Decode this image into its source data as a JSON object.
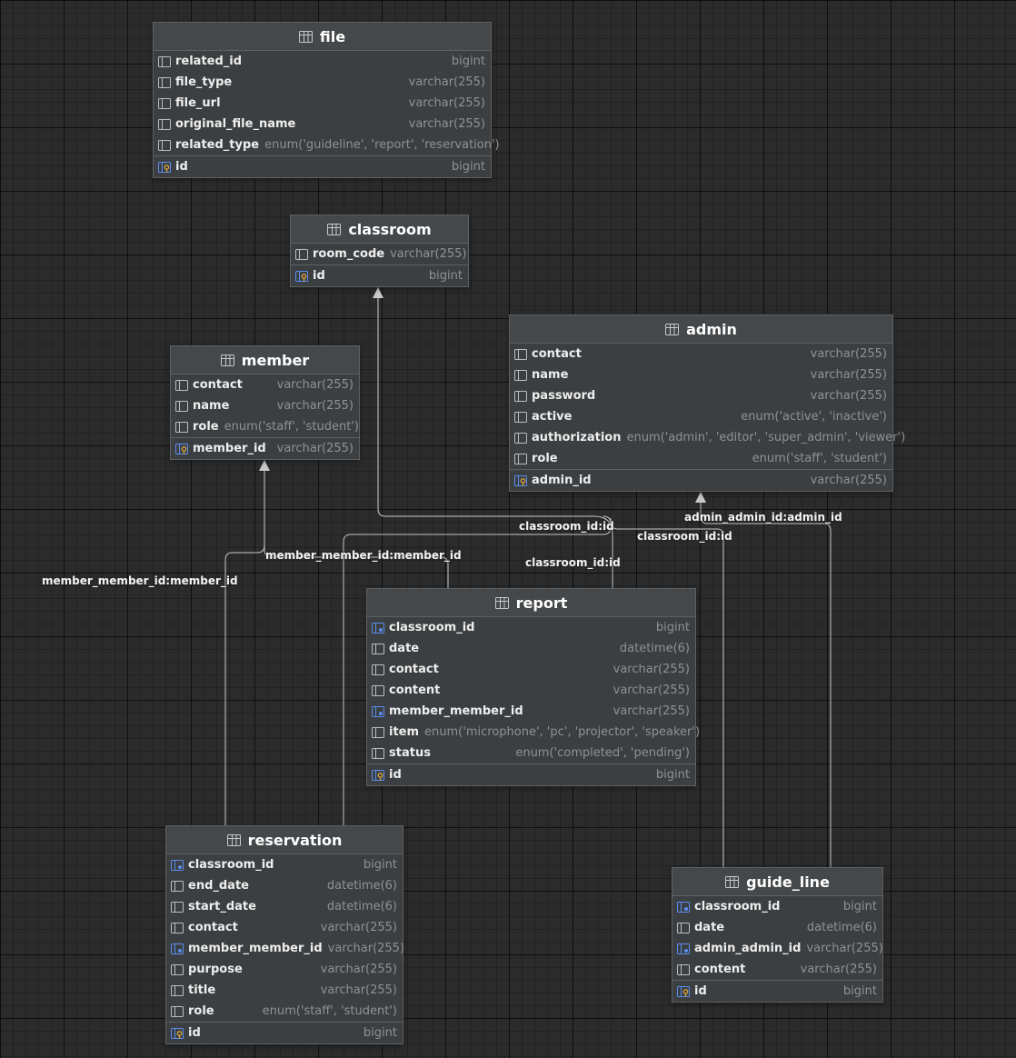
{
  "tables": [
    {
      "key": "file",
      "name": "file",
      "columns": [
        {
          "name": "related_id",
          "type": "bigint",
          "kind": "col"
        },
        {
          "name": "file_type",
          "type": "varchar(255)",
          "kind": "col"
        },
        {
          "name": "file_url",
          "type": "varchar(255)",
          "kind": "col"
        },
        {
          "name": "original_file_name",
          "type": "varchar(255)",
          "kind": "col"
        },
        {
          "name": "related_type",
          "type": "enum('guideline', 'report', 'reservation')",
          "kind": "col"
        }
      ],
      "pk": {
        "name": "id",
        "type": "bigint"
      }
    },
    {
      "key": "classroom",
      "name": "classroom",
      "columns": [
        {
          "name": "room_code",
          "type": "varchar(255)",
          "kind": "col"
        }
      ],
      "pk": {
        "name": "id",
        "type": "bigint"
      }
    },
    {
      "key": "admin",
      "name": "admin",
      "columns": [
        {
          "name": "contact",
          "type": "varchar(255)",
          "kind": "col"
        },
        {
          "name": "name",
          "type": "varchar(255)",
          "kind": "col"
        },
        {
          "name": "password",
          "type": "varchar(255)",
          "kind": "col"
        },
        {
          "name": "active",
          "type": "enum('active', 'inactive')",
          "kind": "col"
        },
        {
          "name": "authorization",
          "type": "enum('admin', 'editor', 'super_admin', 'viewer')",
          "kind": "col"
        },
        {
          "name": "role",
          "type": "enum('staff', 'student')",
          "kind": "col"
        }
      ],
      "pk": {
        "name": "admin_id",
        "type": "varchar(255)"
      }
    },
    {
      "key": "member",
      "name": "member",
      "columns": [
        {
          "name": "contact",
          "type": "varchar(255)",
          "kind": "col"
        },
        {
          "name": "name",
          "type": "varchar(255)",
          "kind": "col"
        },
        {
          "name": "role",
          "type": "enum('staff', 'student')",
          "kind": "col"
        }
      ],
      "pk": {
        "name": "member_id",
        "type": "varchar(255)"
      }
    },
    {
      "key": "report",
      "name": "report",
      "columns": [
        {
          "name": "classroom_id",
          "type": "bigint",
          "kind": "fk"
        },
        {
          "name": "date",
          "type": "datetime(6)",
          "kind": "col"
        },
        {
          "name": "contact",
          "type": "varchar(255)",
          "kind": "col"
        },
        {
          "name": "content",
          "type": "varchar(255)",
          "kind": "col"
        },
        {
          "name": "member_member_id",
          "type": "varchar(255)",
          "kind": "fk"
        },
        {
          "name": "item",
          "type": "enum('microphone', 'pc', 'projector', 'speaker')",
          "kind": "col"
        },
        {
          "name": "status",
          "type": "enum('completed', 'pending')",
          "kind": "col"
        }
      ],
      "pk": {
        "name": "id",
        "type": "bigint"
      }
    },
    {
      "key": "reservation",
      "name": "reservation",
      "columns": [
        {
          "name": "classroom_id",
          "type": "bigint",
          "kind": "fk"
        },
        {
          "name": "end_date",
          "type": "datetime(6)",
          "kind": "col"
        },
        {
          "name": "start_date",
          "type": "datetime(6)",
          "kind": "col"
        },
        {
          "name": "contact",
          "type": "varchar(255)",
          "kind": "col"
        },
        {
          "name": "member_member_id",
          "type": "varchar(255)",
          "kind": "fk"
        },
        {
          "name": "purpose",
          "type": "varchar(255)",
          "kind": "col"
        },
        {
          "name": "title",
          "type": "varchar(255)",
          "kind": "col"
        },
        {
          "name": "role",
          "type": "enum('staff', 'student')",
          "kind": "col"
        }
      ],
      "pk": {
        "name": "id",
        "type": "bigint"
      }
    },
    {
      "key": "guide_line",
      "name": "guide_line",
      "columns": [
        {
          "name": "classroom_id",
          "type": "bigint",
          "kind": "fk"
        },
        {
          "name": "date",
          "type": "datetime(6)",
          "kind": "col"
        },
        {
          "name": "admin_admin_id",
          "type": "varchar(255)",
          "kind": "fk"
        },
        {
          "name": "content",
          "type": "varchar(255)",
          "kind": "col"
        }
      ],
      "pk": {
        "name": "id",
        "type": "bigint"
      }
    }
  ],
  "edge_labels": [
    {
      "key": "report_classroom",
      "text": "classroom_id:id"
    },
    {
      "key": "reservation_classroom",
      "text": "classroom_id:id"
    },
    {
      "key": "guide_line_classroom",
      "text": "classroom_id:id"
    },
    {
      "key": "guide_line_admin",
      "text": "admin_admin_id:admin_id"
    },
    {
      "key": "report_member",
      "text": "member_member_id:member_id"
    },
    {
      "key": "reservation_member",
      "text": "member_member_id:member_id"
    }
  ],
  "colors": {
    "line": "#c9c9c9",
    "fk_icon": "#5b8def",
    "pk_icon": "#d9a441"
  }
}
